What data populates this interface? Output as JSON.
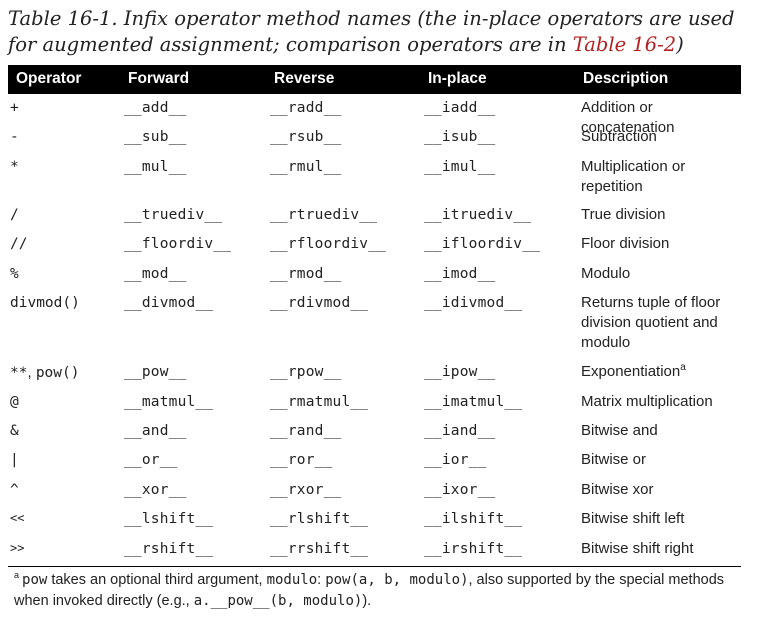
{
  "caption": {
    "text": "Table 16-1. Infix operator method names (the in-place operators are used for augmented assignment; comparison operators are in ",
    "link": "Table 16-2",
    "close": ")"
  },
  "headers": {
    "operator": "Operator",
    "forward": "Forward",
    "reverse": "Reverse",
    "inplace": "In-place",
    "description": "Description"
  },
  "rows": [
    {
      "op": "+",
      "fw": "__add__",
      "rv": "__radd__",
      "ip": "__iadd__",
      "desc": "Addition or concatenation"
    },
    {
      "op": "-",
      "fw": "__sub__",
      "rv": "__rsub__",
      "ip": "__isub__",
      "desc": "Subtraction"
    },
    {
      "op": "*",
      "fw": "__mul__",
      "rv": "__rmul__",
      "ip": "__imul__",
      "desc": "Multiplication or repetition"
    },
    {
      "op": "/",
      "fw": "__truediv__",
      "rv": "__rtruediv__",
      "ip": "__itruediv__",
      "desc": "True division"
    },
    {
      "op": "//",
      "fw": "__floordiv__",
      "rv": "__rfloordiv__",
      "ip": "__ifloordiv__",
      "desc": "Floor division"
    },
    {
      "op": "%",
      "fw": "__mod__",
      "rv": "__rmod__",
      "ip": "__imod__",
      "desc": "Modulo"
    },
    {
      "op": "divmod()",
      "fw": "__divmod__",
      "rv": "__rdivmod__",
      "ip": "__idivmod__",
      "desc": "Returns tuple of floor division quotient and modulo"
    },
    {
      "op_a": "**",
      "op_b": ", ",
      "op_c": "pow()",
      "fw": "__pow__",
      "rv": "__rpow__",
      "ip": "__ipow__",
      "desc": "Exponentiation",
      "desc_sup": "a"
    },
    {
      "op": "@",
      "fw": "__matmul__",
      "rv": "__rmatmul__",
      "ip": "__imatmul__",
      "desc": "Matrix multiplication"
    },
    {
      "op": "&",
      "fw": "__and__",
      "rv": "__rand__",
      "ip": "__iand__",
      "desc": "Bitwise and"
    },
    {
      "op": "|",
      "fw": "__or__",
      "rv": "__ror__",
      "ip": "__ior__",
      "desc": "Bitwise or"
    },
    {
      "op": "^",
      "fw": "__xor__",
      "rv": "__rxor__",
      "ip": "__ixor__",
      "desc": "Bitwise xor"
    },
    {
      "op": "<<",
      "fw": "__lshift__",
      "rv": "__rlshift__",
      "ip": "__ilshift__",
      "desc": "Bitwise shift left"
    },
    {
      "op": ">>",
      "fw": "__rshift__",
      "rv": "__rrshift__",
      "ip": "__irshift__",
      "desc": "Bitwise shift right"
    }
  ],
  "footnote": {
    "marker": "a",
    "part1_code": "pow",
    "part2": " takes an optional third argument, ",
    "part3_code": "modulo",
    "part4": ": ",
    "part5_code": "pow(a, b, modulo)",
    "part6": ", also supported by the special methods when invoked directly (e.g., ",
    "part7_code": "a.__pow__(b, modulo)",
    "part8": ")."
  },
  "colors": {
    "header_bg": "#000000",
    "header_fg": "#ffffff",
    "link": "#b22222"
  }
}
